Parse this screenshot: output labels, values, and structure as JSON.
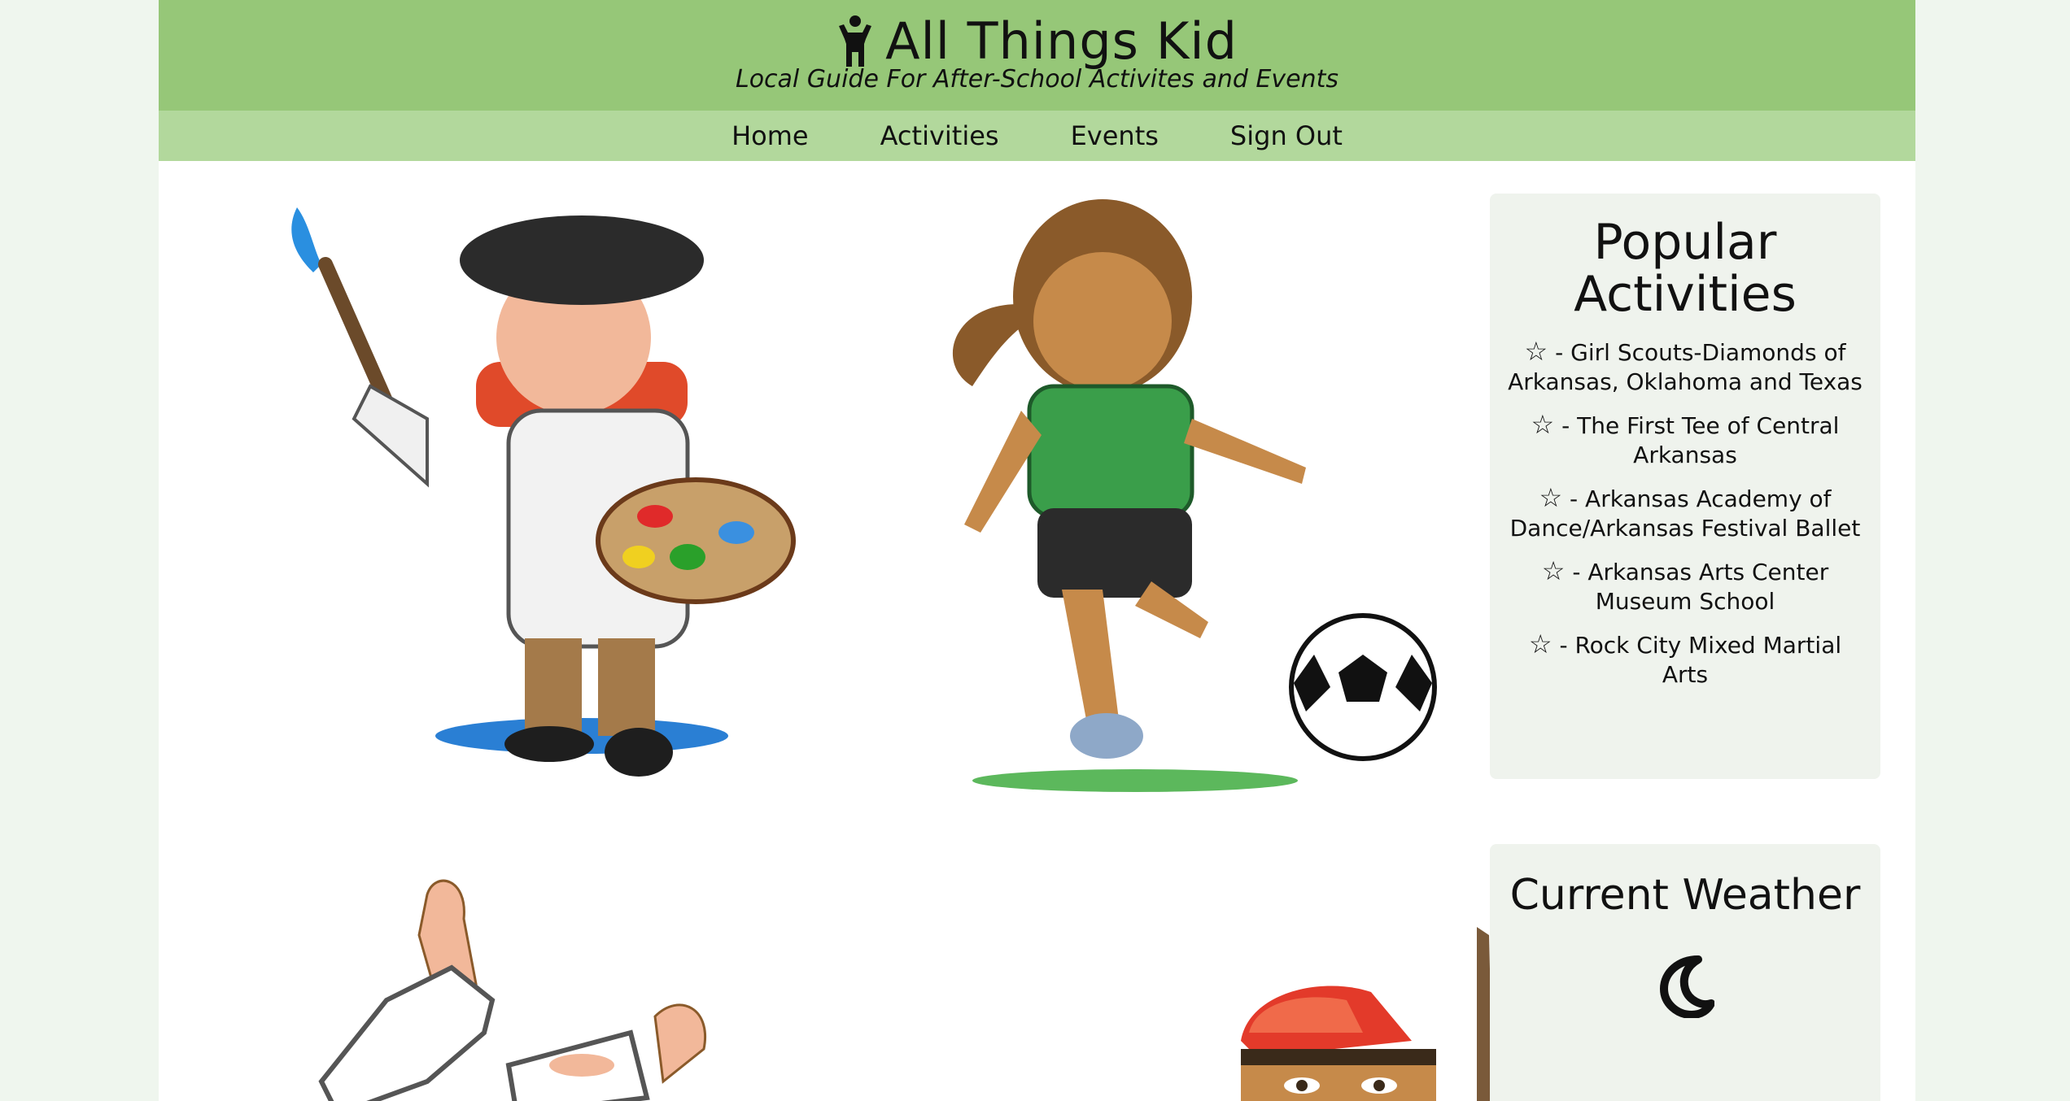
{
  "header": {
    "title": "All Things Kid",
    "tagline": "Local Guide For After-School Activites and Events",
    "logo_icon": "child-icon"
  },
  "nav": {
    "items": [
      {
        "label": "Home"
      },
      {
        "label": "Activities"
      },
      {
        "label": "Events"
      },
      {
        "label": "Sign Out"
      }
    ]
  },
  "popular": {
    "title": "Popular Activities",
    "items": [
      {
        "icon": "star-icon",
        "label": "- Girl Scouts-Diamonds of Arkansas, Oklahoma and Texas"
      },
      {
        "icon": "star-icon",
        "label": "- The First Tee of Central Arkansas"
      },
      {
        "icon": "star-icon",
        "label": "- Arkansas Academy of Dance/Arkansas Festival Ballet"
      },
      {
        "icon": "star-icon",
        "label": "- Arkansas Arts Center Museum School"
      },
      {
        "icon": "star-icon",
        "label": "- Rock City Mixed Martial Arts"
      }
    ]
  },
  "weather": {
    "title": "Current Weather",
    "icon": "moon-icon"
  },
  "colors": {
    "header_bg": "#96c778",
    "nav_bg": "#b2d89c",
    "page_bg": "#eff6ee",
    "sidebar_bg": "#eff3ed"
  }
}
